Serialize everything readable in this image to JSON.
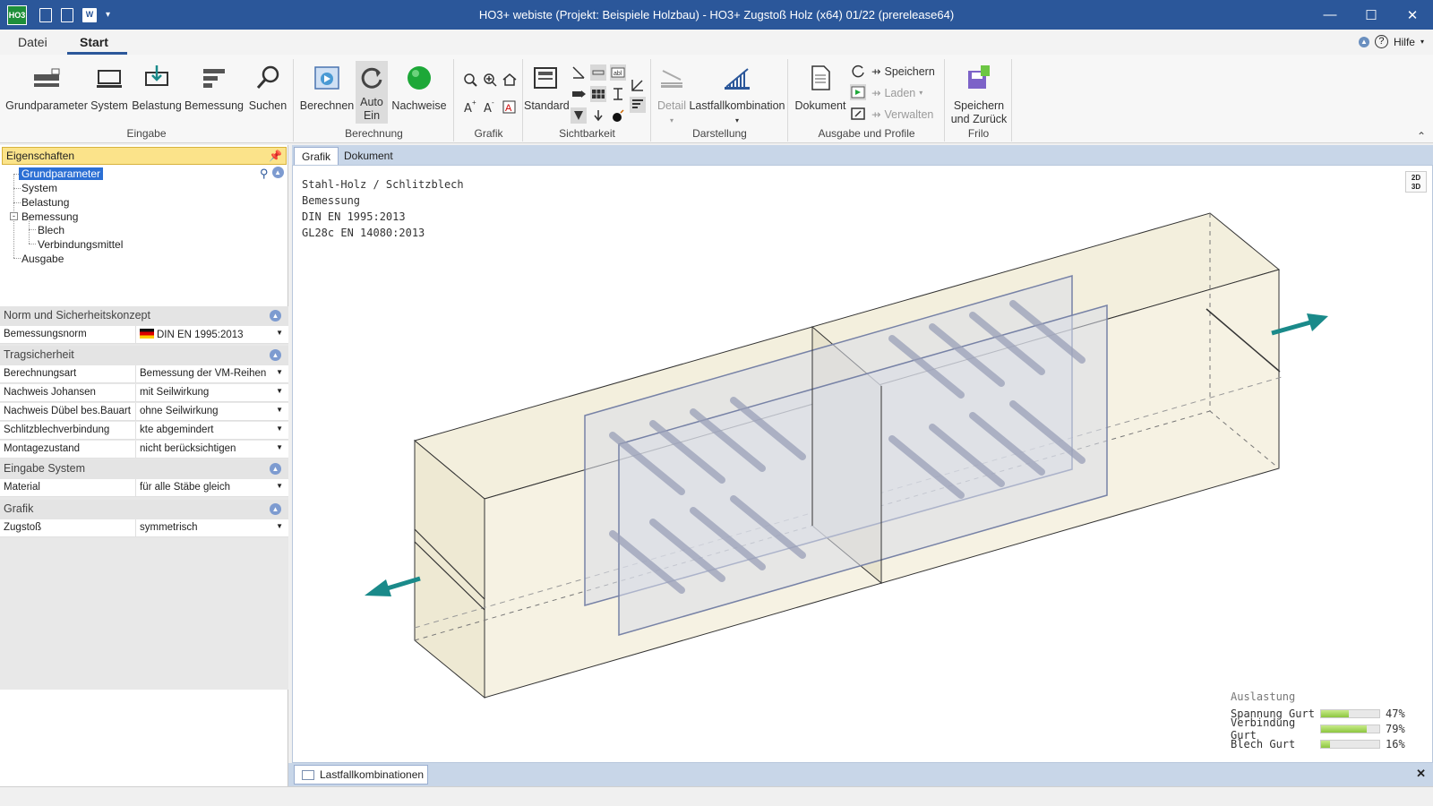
{
  "window": {
    "title": "HO3+ webiste (Projekt: Beispiele Holzbau) - HO3+ Zugstoß Holz (x64) 01/22 (prerelease64)",
    "logo": "HO3"
  },
  "menu_tabs": {
    "datei": "Datei",
    "start": "Start",
    "hilfe": "Hilfe"
  },
  "ribbon": {
    "eingabe": {
      "label": "Eingabe",
      "grundparameter": "Grundparameter",
      "system": "System",
      "belastung": "Belastung",
      "bemessung": "Bemessung",
      "suchen": "Suchen"
    },
    "berechnung": {
      "label": "Berechnung",
      "berechnen": "Berechnen",
      "auto_ein_1": "Auto",
      "auto_ein_2": "Ein",
      "nachweise": "Nachweise"
    },
    "grafik": {
      "label": "Grafik"
    },
    "sichtbarkeit": {
      "label": "Sichtbarkeit",
      "standard": "Standard"
    },
    "darstellung": {
      "label": "Darstellung",
      "detail": "Detail",
      "lastfallkombination": "Lastfallkombination"
    },
    "ausgabe": {
      "label": "Ausgabe und Profile",
      "dokument": "Dokument",
      "speichern": "Speichern",
      "laden": "Laden",
      "verwalten": "Verwalten"
    },
    "frilo": {
      "label": "Frilo",
      "speichern_zurueck_1": "Speichern",
      "speichern_zurueck_2": "und Zurück"
    }
  },
  "left_panel": {
    "title": "Eigenschaften",
    "tree": [
      "Grundparameter",
      "System",
      "Belastung",
      "Bemessung",
      "Blech",
      "Verbindungsmittel",
      "Ausgabe"
    ],
    "sections": {
      "norm": "Norm und Sicherheitskonzept",
      "trag": "Tragsicherheit",
      "eingabe_system": "Eingabe System",
      "grafik": "Grafik"
    },
    "rows": {
      "bemessungsnorm": {
        "k": "Bemessungsnorm",
        "v": "DIN EN 1995:2013"
      },
      "berechnungsart": {
        "k": "Berechnungsart",
        "v": "Bemessung der VM-Reihen"
      },
      "johansen": {
        "k": "Nachweis Johansen",
        "v": "mit Seilwirkung"
      },
      "duebel": {
        "k": "Nachweis Dübel bes.Bauart",
        "v": "ohne Seilwirkung"
      },
      "schlitz": {
        "k": "Schlitzblechverbindung",
        "v": "kte abgemindert"
      },
      "montage": {
        "k": "Montagezustand",
        "v": "nicht berücksichtigen"
      },
      "material": {
        "k": "Material",
        "v": "für alle Stäbe gleich"
      },
      "zugstoss": {
        "k": "Zugstoß",
        "v": "symmetrisch"
      }
    }
  },
  "doc_tabs": {
    "grafik": "Grafik",
    "dokument": "Dokument"
  },
  "drawing": {
    "info": [
      "Stahl-Holz / Schlitzblech",
      "Bemessung",
      "DIN EN 1995:2013",
      "GL28c EN 14080:2013"
    ],
    "view_toggle_1": "2D",
    "view_toggle_2": "3D",
    "utilization": {
      "title": "Auslastung",
      "items": [
        {
          "label": "Spannung Gurt",
          "pct": "47%",
          "value": 0.47
        },
        {
          "label": "Verbindung Gurt",
          "pct": "79%",
          "value": 0.79
        },
        {
          "label": "Blech Gurt",
          "pct": "16%",
          "value": 0.16
        }
      ]
    }
  },
  "bottom": {
    "tab": "Lastfallkombinationen"
  },
  "colors": {
    "accent": "#2b579a",
    "wood": "#f3efdd",
    "arrow": "#1a8a8a",
    "bar": "#8cc63f"
  }
}
